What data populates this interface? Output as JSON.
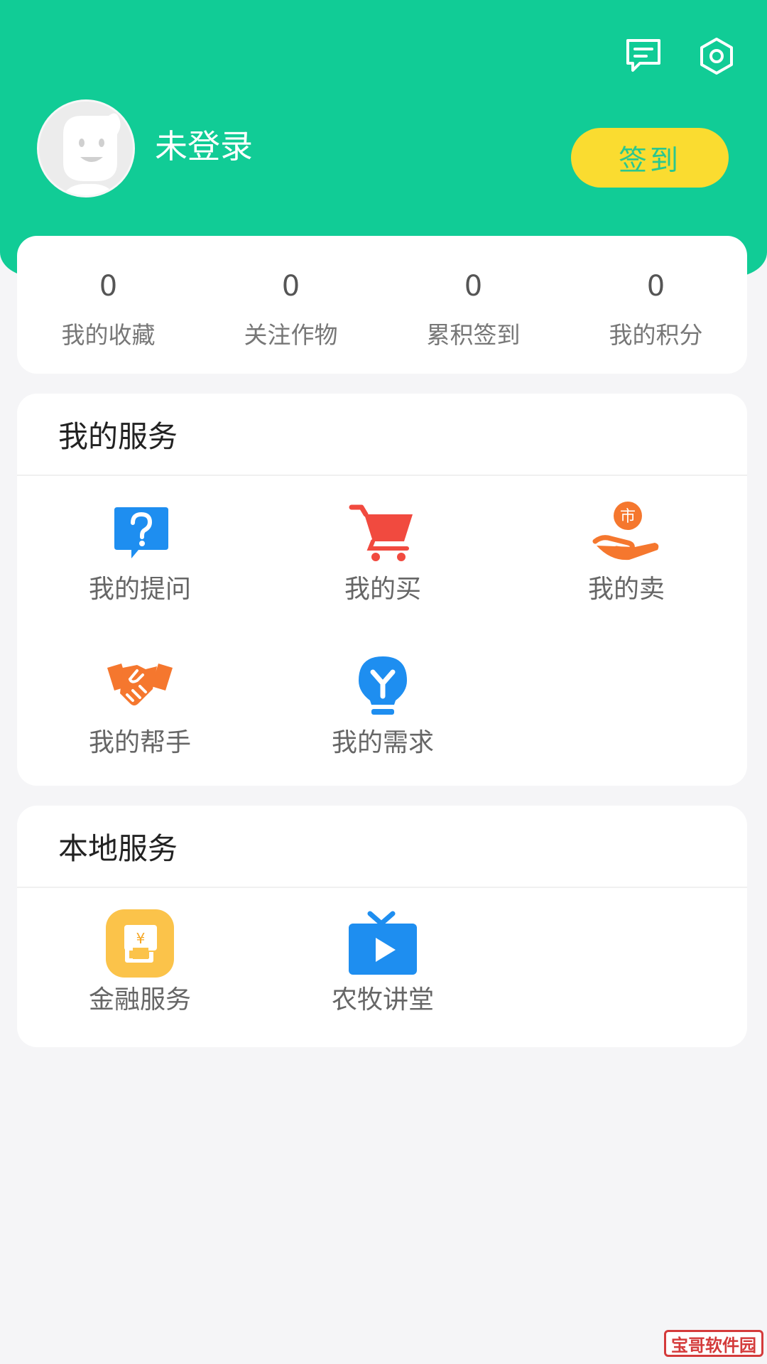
{
  "header": {
    "background_color": "#11cc96",
    "icons": [
      "message-icon",
      "settings-icon"
    ],
    "login_status": "未登录",
    "signin_label": "签到"
  },
  "stats": [
    {
      "value": "0",
      "label": "我的收藏"
    },
    {
      "value": "0",
      "label": "关注作物"
    },
    {
      "value": "0",
      "label": "累积签到"
    },
    {
      "value": "0",
      "label": "我的积分"
    }
  ],
  "my_services": {
    "title": "我的服务",
    "items": [
      {
        "label": "我的提问",
        "icon": "question-icon"
      },
      {
        "label": "我的买",
        "icon": "cart-icon"
      },
      {
        "label": "我的卖",
        "icon": "sell-hand-icon"
      },
      {
        "label": "我的帮手",
        "icon": "handshake-icon"
      },
      {
        "label": "我的需求",
        "icon": "lightbulb-icon"
      }
    ]
  },
  "local_services": {
    "title": "本地服务",
    "items": [
      {
        "label": "金融服务",
        "icon": "finance-icon"
      },
      {
        "label": "农牧讲堂",
        "icon": "tv-icon"
      }
    ]
  },
  "watermark": "宝哥软件园",
  "colors": {
    "primary": "#11cc96",
    "signin_button": "#fadc30",
    "blue_icon": "#1e8ef0",
    "orange_icon": "#f5772e",
    "red_icon": "#f14a3f",
    "page_background": "#f5f5f7"
  }
}
